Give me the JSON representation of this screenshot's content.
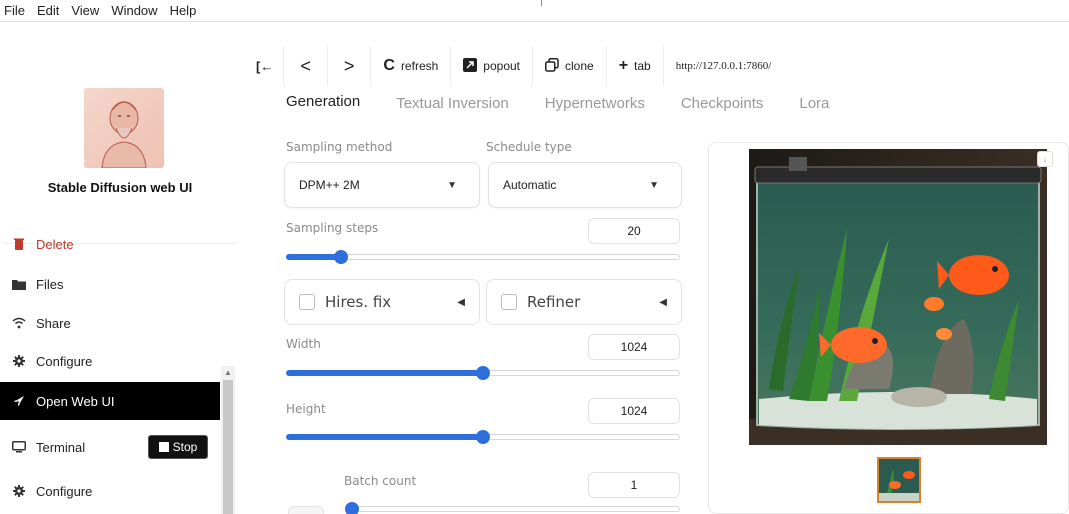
{
  "menubar": {
    "items": [
      "File",
      "Edit",
      "View",
      "Window",
      "Help"
    ]
  },
  "sidebar": {
    "app_title": "Stable Diffusion web UI",
    "items": [
      {
        "label": "Delete",
        "icon": "trash-icon"
      },
      {
        "label": "Files",
        "icon": "folder-icon"
      },
      {
        "label": "Share",
        "icon": "wifi-icon"
      },
      {
        "label": "Configure",
        "icon": "gear-icon"
      },
      {
        "label": "Open Web UI",
        "icon": "rocket-icon"
      },
      {
        "label": "Terminal",
        "icon": "monitor-icon"
      },
      {
        "label": "Configure",
        "icon": "gear-icon"
      }
    ],
    "stop_label": "Stop"
  },
  "toolbar": {
    "back_label": "<",
    "forward_label": ">",
    "refresh_label": "refresh",
    "popout_label": "popout",
    "clone_label": "clone",
    "tab_label": "tab",
    "url": "http://127.0.0.1:7860/"
  },
  "tabs": [
    "Generation",
    "Textual Inversion",
    "Hypernetworks",
    "Checkpoints",
    "Lora"
  ],
  "generation": {
    "sampling_method_label": "Sampling method",
    "sampling_method_value": "DPM++ 2M",
    "schedule_type_label": "Schedule type",
    "schedule_type_value": "Automatic",
    "sampling_steps_label": "Sampling steps",
    "sampling_steps_value": "20",
    "sampling_steps_fraction": 0.14,
    "hires_fix_label": "Hires. fix",
    "refiner_label": "Refiner",
    "width_label": "Width",
    "width_value": "1024",
    "width_fraction": 0.5,
    "height_label": "Height",
    "height_value": "1024",
    "height_fraction": 0.5,
    "batch_count_label": "Batch count",
    "batch_count_value": "1",
    "batch_count_fraction": 0.0
  },
  "colors": {
    "accent": "#2f6fdd",
    "active_bg": "#000000",
    "delete": "#c0392b"
  }
}
